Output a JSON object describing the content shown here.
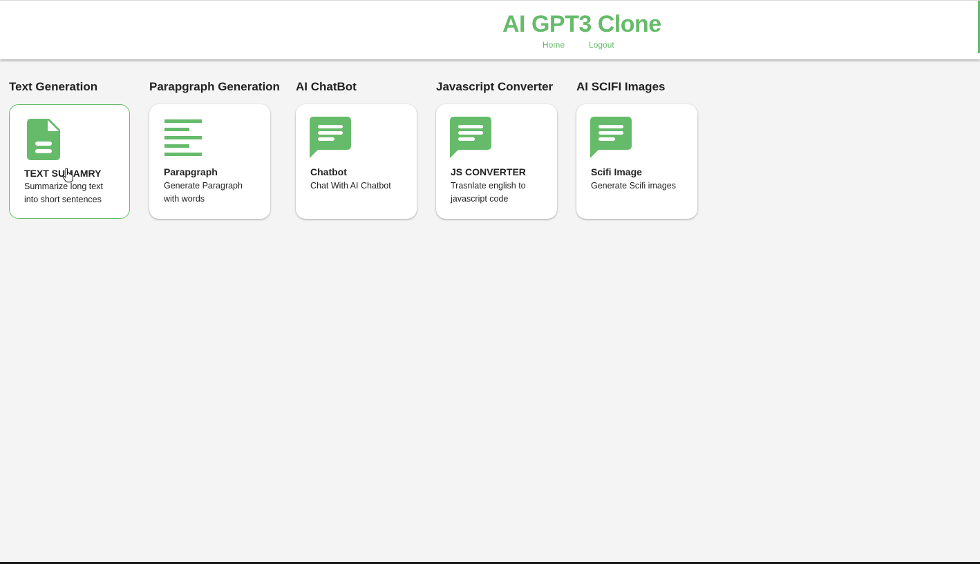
{
  "header": {
    "title": "AI GPT3 Clone",
    "nav": [
      "Home",
      "Logout"
    ]
  },
  "sections": [
    {
      "heading": "Text Generation",
      "card": {
        "icon": "document-icon",
        "title": "TEXT SUMAMRY",
        "description": "Summarize long text into short sentences",
        "active": true
      }
    },
    {
      "heading": "Parapgraph Generation",
      "card": {
        "icon": "paragraph-align-icon",
        "title": "Parapgraph",
        "description": "Generate Paragraph with words"
      }
    },
    {
      "heading": "AI ChatBot",
      "card": {
        "icon": "chat-icon",
        "title": "Chatbot",
        "description": "Chat With AI Chatbot"
      }
    },
    {
      "heading": "Javascript Converter",
      "card": {
        "icon": "chat-icon",
        "title": "JS CONVERTER",
        "description": "Trasnlate english to javascript code"
      }
    },
    {
      "heading": "AI SCIFI Images",
      "card": {
        "icon": "chat-icon",
        "title": "Scifi Image",
        "description": "Generate Scifi images"
      }
    }
  ],
  "colors": {
    "accent": "#66bb6a",
    "background": "#f4f4f4",
    "text": "#222222"
  }
}
